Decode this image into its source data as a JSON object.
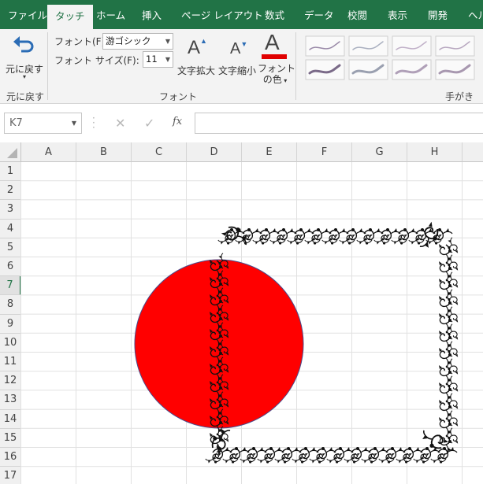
{
  "tabs": [
    "ファイル",
    "タッチ",
    "ホーム",
    "挿入",
    "ページ レイアウト",
    "数式",
    "データ",
    "校閲",
    "表示",
    "開発",
    "ヘル"
  ],
  "ribbon": {
    "undo": {
      "label": "元に戻す",
      "group": "元に戻す"
    },
    "font": {
      "font_label": "フォント(F):",
      "font_value": "游ゴシック",
      "size_label": "フォント サイズ(F):",
      "size_value": "11",
      "grow_label": "文字拡大",
      "shrink_label": "文字縮小",
      "color_label_1": "フォント",
      "color_label_2": "の色",
      "group": "フォント"
    },
    "pens_group": "手がき"
  },
  "formula_bar": {
    "name_box": "K7",
    "fx": "fx",
    "content": ""
  },
  "columns": [
    "A",
    "B",
    "C",
    "D",
    "E",
    "F",
    "G",
    "H"
  ],
  "rows": [
    "1",
    "2",
    "3",
    "4",
    "5",
    "6",
    "7",
    "8",
    "9",
    "10",
    "11",
    "12",
    "13",
    "14",
    "15",
    "16",
    "17"
  ],
  "selected_row": "7",
  "colors": {
    "brand": "#217346",
    "circle": "#ff0000",
    "font_color": "#e00000"
  }
}
